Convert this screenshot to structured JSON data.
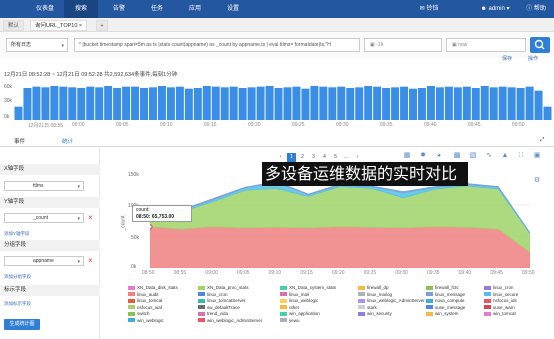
{
  "nav": {
    "items": [
      "仪表盘",
      "搜索",
      "告警",
      "任务",
      "应用",
      "设置"
    ],
    "active_index": 1,
    "right": {
      "bell_label": "铃铛",
      "user_label": "admin",
      "help_label": "帮助"
    }
  },
  "tabs": [
    {
      "label": "默认"
    },
    {
      "label": "询问URL_TOP10",
      "active": true
    }
  ],
  "search": {
    "source_label": "所有日志",
    "query": "* |bucket timestamp span=5m as ts |stats count(appname) as _count by appname,ts | eval ttlms= formatdate(ts,\"H",
    "time_from": "-1h",
    "time_to": "now",
    "options_label": "保存",
    "help_label": "操作"
  },
  "summary": "12月21日 08:52:28 ~ 12月21日 09:52:28 共2,592,634条事件,每刻1分钟",
  "histogram": {
    "y_ticks": [
      "60k",
      "30k",
      "0k"
    ],
    "x_ticks": [
      "12月21日 08:55",
      "09:00",
      "09:05",
      "09:10",
      "09:15",
      "09:20",
      "09:25",
      "09:30",
      "09:35",
      "09:40",
      "09:45",
      "09:50"
    ],
    "values": [
      20,
      48,
      50,
      49,
      51,
      50,
      49,
      48,
      50,
      49,
      51,
      48,
      50,
      50,
      48,
      49,
      51,
      49,
      50,
      47,
      48,
      51,
      50,
      49,
      50,
      48,
      49,
      50,
      51,
      48,
      49,
      50,
      47,
      51,
      50,
      49,
      50,
      48,
      49,
      51,
      50,
      48,
      49,
      50,
      47,
      48,
      51,
      49,
      50,
      49,
      50,
      48,
      51,
      49,
      50,
      49,
      48,
      50,
      44,
      20
    ]
  },
  "lower_tabs": {
    "events": "事件",
    "stats": "统计"
  },
  "sidebar": {
    "x_title": "X轴字段",
    "x_value": "ttlms",
    "y_title": "Y轴字段",
    "y_value": "_count",
    "add_y": "添加Y轴字段",
    "group_title": "分组字段",
    "group_value": "appname",
    "add_group": "添加分组字段",
    "label_title": "标示字段",
    "add_label": "添加标示字段",
    "generate_btn": "生成统计图"
  },
  "pager": [
    "‹",
    "1",
    "2",
    "3",
    "4",
    "5",
    "…",
    "›"
  ],
  "overlay_text": "多设备运维数据的实时对比",
  "tooltip": {
    "line1": "count:",
    "line2": "08:50: 65,753.00"
  },
  "chart": {
    "y_ticks": [
      "150k",
      "100k",
      "50k",
      "0k"
    ],
    "y_label": "_count",
    "x_ticks": [
      "08:50",
      "08:55",
      "09:00",
      "09:05",
      "09:10",
      "09:15",
      "09:20",
      "09:25",
      "09:30",
      "09:35",
      "09:40",
      "09:45",
      "09:50"
    ]
  },
  "chart_data": {
    "type": "area",
    "x": [
      "08:50",
      "08:55",
      "09:00",
      "09:05",
      "09:10",
      "09:15",
      "09:20",
      "09:25",
      "09:30",
      "09:35",
      "09:40",
      "09:45",
      "09:50"
    ],
    "ylim": [
      0,
      150000
    ],
    "ylabel": "_count",
    "series": [
      {
        "name": "linux_audit",
        "color": "#f08080",
        "values": [
          65753,
          62000,
          66000,
          64000,
          65000,
          64000,
          66000,
          65000,
          64000,
          66000,
          65000,
          62000,
          25000
        ]
      },
      {
        "name": "XN_Data_proc_stats",
        "color": "#a0d468",
        "values": [
          20000,
          28000,
          40000,
          60000,
          62000,
          50000,
          64000,
          62000,
          48000,
          60000,
          66000,
          64000,
          30000
        ]
      },
      {
        "name": "linux_secure",
        "color": "#4fc1e9",
        "values": [
          3000,
          2000,
          3000,
          4000,
          9000,
          3000,
          2000,
          3000,
          8000,
          3000,
          2000,
          3000,
          1000
        ]
      },
      {
        "name": "linux_message",
        "color": "#7a9fd6",
        "values": [
          2000,
          1000,
          2000,
          1000,
          2000,
          1000,
          2000,
          1000,
          2000,
          1000,
          2000,
          1000,
          500
        ]
      }
    ]
  },
  "legend": [
    {
      "name": "XN_Data_disk_stats",
      "color": "#e37bd3"
    },
    {
      "name": "XN_Data_proc_stats",
      "color": "#a0d468"
    },
    {
      "name": "XN_Data_system_stats",
      "color": "#48cfad"
    },
    {
      "name": "firewall_dp",
      "color": "#f6bb42"
    },
    {
      "name": "firewall_h3c",
      "color": "#8cc152"
    },
    {
      "name": "linux_cron",
      "color": "#967adc"
    },
    {
      "name": "linux_audit",
      "color": "#f08080"
    },
    {
      "name": "linux_cron",
      "color": "#4a89dc"
    },
    {
      "name": "linux_mail",
      "color": "#d770ad"
    },
    {
      "name": "linux_mailog",
      "color": "#aab2bd"
    },
    {
      "name": "linux_message",
      "color": "#7a9fd6"
    },
    {
      "name": "linux_secure",
      "color": "#4fc1e9"
    },
    {
      "name": "linux_tomcat",
      "color": "#e9573f"
    },
    {
      "name": "linux_tomcatServer",
      "color": "#37bc9b"
    },
    {
      "name": "linux_weblogic",
      "color": "#ffce54"
    },
    {
      "name": "linux_weblogic_AdminServer",
      "color": "#ac92ec"
    },
    {
      "name": "nova_compute",
      "color": "#3bafda"
    },
    {
      "name": "nsfocus_ids",
      "color": "#ed5565"
    },
    {
      "name": "nsfocus_waf",
      "color": "#a0d468"
    },
    {
      "name": "sw_defaultTrace",
      "color": "#656d78"
    },
    {
      "name": "other",
      "color": "#f6bb42"
    },
    {
      "name": "stark",
      "color": "#ccd1d9"
    },
    {
      "name": "suse_message",
      "color": "#4a89dc"
    },
    {
      "name": "suse_warn",
      "color": "#da4453"
    },
    {
      "name": "switch",
      "color": "#8cc152"
    },
    {
      "name": "trend_vida",
      "color": "#d770ad"
    },
    {
      "name": "win_application",
      "color": "#48cfad"
    },
    {
      "name": "win_security",
      "color": "#967adc"
    },
    {
      "name": "win_system",
      "color": "#f6bb42"
    },
    {
      "name": "win_tomcat",
      "color": "#e37bd3"
    },
    {
      "name": "win_weblogic",
      "color": "#3bafda"
    },
    {
      "name": "win_weblogic_AdminServer",
      "color": "#ed5565"
    },
    {
      "name": "yewu",
      "color": "#aab2bd"
    }
  ]
}
